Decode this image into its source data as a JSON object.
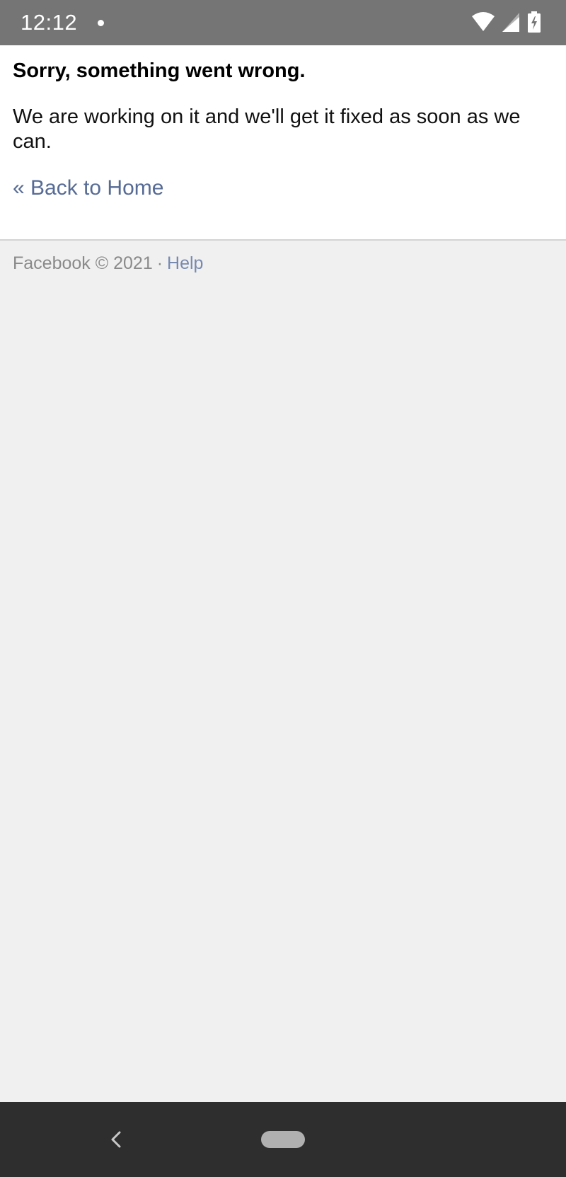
{
  "status_bar": {
    "time": "12:12",
    "icons": [
      "notification-dot-icon",
      "wifi-icon",
      "cell-signal-icon",
      "battery-charging-icon"
    ]
  },
  "error": {
    "title": "Sorry, something went wrong.",
    "message": "We are working on it and we'll get it fixed as soon as we can.",
    "back_link": "« Back to Home"
  },
  "footer": {
    "copyright": "Facebook © 2021",
    "separator": "·",
    "help_link": "Help"
  },
  "nav_bar": {
    "icons": [
      "back-chevron-icon",
      "home-pill-icon"
    ]
  },
  "colors": {
    "status_bar_bg": "#757575",
    "link": "#576b95",
    "page_bg": "#f0f0f0",
    "nav_bar_bg": "#2e2e2e"
  }
}
